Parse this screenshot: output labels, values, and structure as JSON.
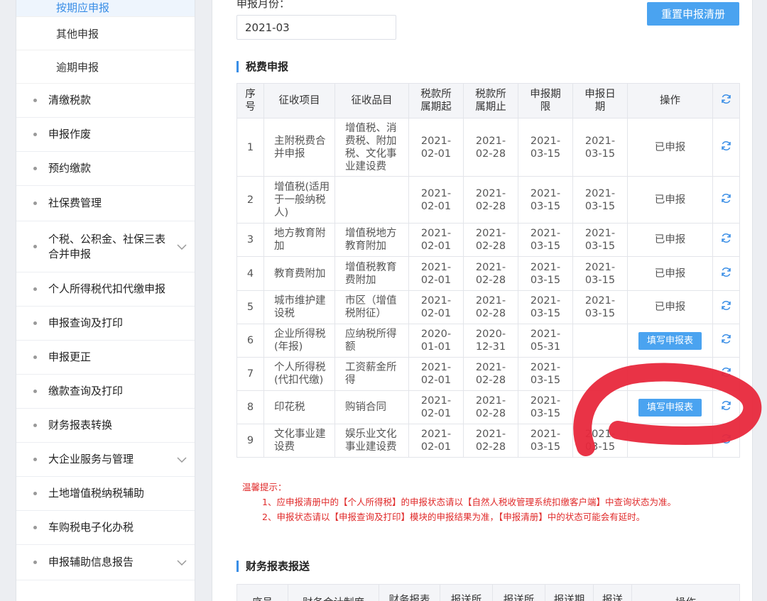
{
  "sidebar": {
    "sub_items": [
      {
        "label": "按期应申报"
      },
      {
        "label": "其他申报"
      },
      {
        "label": "逾期申报"
      }
    ],
    "items": [
      {
        "label": "清缴税款",
        "expand": false
      },
      {
        "label": "申报作废",
        "expand": false
      },
      {
        "label": "预约缴款",
        "expand": false
      },
      {
        "label": "社保费管理",
        "expand": false
      },
      {
        "label": "个税、公积金、社保三表合并申报",
        "expand": true
      },
      {
        "label": "个人所得税代扣代缴申报",
        "expand": false
      },
      {
        "label": "申报查询及打印",
        "expand": false
      },
      {
        "label": "申报更正",
        "expand": false
      },
      {
        "label": "缴款查询及打印",
        "expand": false
      },
      {
        "label": "财务报表转换",
        "expand": false
      },
      {
        "label": "大企业服务与管理",
        "expand": true
      },
      {
        "label": "土地增值税纳税辅助",
        "expand": false
      },
      {
        "label": "车购税电子化办税",
        "expand": false
      },
      {
        "label": "申报辅助信息报告",
        "expand": true
      }
    ]
  },
  "header": {
    "month_label": "申报月份：",
    "month_value": "2021-03",
    "reset_button": "重置申报清册"
  },
  "tax_section": {
    "title": "税费申报",
    "columns": [
      "序号",
      "征收项目",
      "征收品目",
      "税款所属期起",
      "税款所属期止",
      "申报期限",
      "申报日期",
      "操作"
    ],
    "rows": [
      {
        "no": "1",
        "item": "主附税费合并申报",
        "subitem": "增值税、消费税、附加税、文化事业建设费",
        "start": "2021-02-01",
        "end": "2021-02-28",
        "deadline": "2021-03-15",
        "date": "2021-03-15",
        "status": "已申报",
        "button": ""
      },
      {
        "no": "2",
        "item": "增值税(适用于一般纳税人)",
        "subitem": "",
        "start": "2021-02-01",
        "end": "2021-02-28",
        "deadline": "2021-03-15",
        "date": "2021-03-15",
        "status": "已申报",
        "button": ""
      },
      {
        "no": "3",
        "item": "地方教育附加",
        "subitem": "增值税地方教育附加",
        "start": "2021-02-01",
        "end": "2021-02-28",
        "deadline": "2021-03-15",
        "date": "2021-03-15",
        "status": "已申报",
        "button": ""
      },
      {
        "no": "4",
        "item": "教育费附加",
        "subitem": "增值税教育费附加",
        "start": "2021-02-01",
        "end": "2021-02-28",
        "deadline": "2021-03-15",
        "date": "2021-03-15",
        "status": "已申报",
        "button": ""
      },
      {
        "no": "5",
        "item": "城市维护建设税",
        "subitem": "市区（增值税附征）",
        "start": "2021-02-01",
        "end": "2021-02-28",
        "deadline": "2021-03-15",
        "date": "2021-03-15",
        "status": "已申报",
        "button": ""
      },
      {
        "no": "6",
        "item": "企业所得税(年报)",
        "subitem": "应纳税所得额",
        "start": "2020-01-01",
        "end": "2020-12-31",
        "deadline": "2021-05-31",
        "date": "",
        "status": "",
        "button": "填写申报表"
      },
      {
        "no": "7",
        "item": "个人所得税(代扣代缴)",
        "subitem": "工资薪金所得",
        "start": "2021-02-01",
        "end": "2021-02-28",
        "deadline": "2021-03-15",
        "date": "",
        "status": "",
        "button": ""
      },
      {
        "no": "8",
        "item": "印花税",
        "subitem": "购销合同",
        "start": "2021-02-01",
        "end": "2021-02-28",
        "deadline": "2021-03-15",
        "date": "",
        "status": "",
        "button": "填写申报表"
      },
      {
        "no": "9",
        "item": "文化事业建设费",
        "subitem": "娱乐业文化事业建设费",
        "start": "2021-02-01",
        "end": "2021-02-28",
        "deadline": "2021-03-15",
        "date": "2021-03-15",
        "status": "",
        "button": ""
      }
    ]
  },
  "tips": {
    "title": "温馨提示：",
    "line1": "1、应申报清册中的【个人所得税】的申报状态请以【自然人税收管理系统扣缴客户端】中查询状态为准。",
    "line2": "2、申报状态请以【申报查询及打印】模块的申报结果为准，【申报清册】中的状态可能会有延时。"
  },
  "finance_section": {
    "title": "财务报表报送",
    "columns": [
      "序号",
      "财务会计制度",
      "财务报表",
      "报送所",
      "报送所",
      "报送期",
      "报送",
      "操作"
    ]
  },
  "colors": {
    "accent": "#4aa3f0",
    "tips_text": "#e02a2a",
    "annotation": "#e8283c"
  }
}
